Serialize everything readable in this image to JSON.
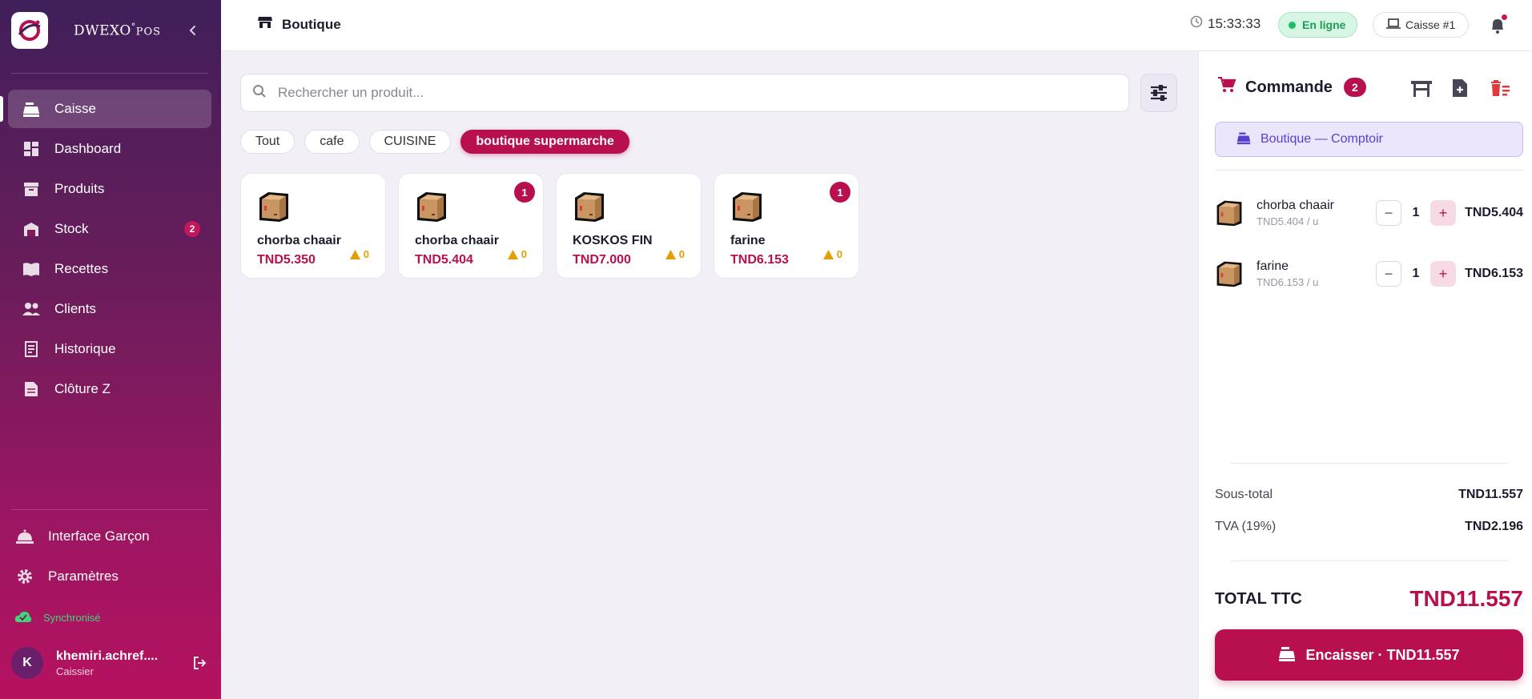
{
  "brand": {
    "name": "DWEXO",
    "suffix": "POS"
  },
  "sidebar": {
    "items": [
      {
        "label": "Caisse",
        "icon": "register-icon",
        "active": true
      },
      {
        "label": "Dashboard",
        "icon": "dashboard-icon"
      },
      {
        "label": "Produits",
        "icon": "box-icon"
      },
      {
        "label": "Stock",
        "icon": "warehouse-icon",
        "badge": "2"
      },
      {
        "label": "Recettes",
        "icon": "book-icon"
      },
      {
        "label": "Clients",
        "icon": "users-icon"
      },
      {
        "label": "Historique",
        "icon": "receipt-icon"
      },
      {
        "label": "Clôture Z",
        "icon": "document-icon"
      }
    ],
    "bottom_items": [
      {
        "label": "Interface Garçon",
        "icon": "cloche-icon"
      },
      {
        "label": "Paramètres",
        "icon": "gear-icon"
      }
    ],
    "sync_status": "Synchronisé",
    "user": {
      "initial": "K",
      "name": "khemiri.achref....",
      "role": "Caissier"
    }
  },
  "topbar": {
    "title": "Boutique",
    "time": "15:33:33",
    "status": "En ligne",
    "register": "Caisse #1"
  },
  "search": {
    "placeholder": "Rechercher un produit..."
  },
  "categories": [
    {
      "label": "Tout"
    },
    {
      "label": "cafe"
    },
    {
      "label": "CUISINE"
    },
    {
      "label": "boutique supermarche",
      "active": true
    }
  ],
  "products": [
    {
      "name": "chorba chaair",
      "price": "TND5.350",
      "stock": "0",
      "in_cart": ""
    },
    {
      "name": "chorba chaair",
      "price": "TND5.404",
      "stock": "0",
      "in_cart": "1"
    },
    {
      "name": "KOSKOS FIN",
      "price": "TND7.000",
      "stock": "0",
      "in_cart": ""
    },
    {
      "name": "farine",
      "price": "TND6.153",
      "stock": "0",
      "in_cart": "1"
    }
  ],
  "order": {
    "title": "Commande",
    "count": "2",
    "table": "Boutique — Comptoir",
    "lines": [
      {
        "name": "chorba chaair",
        "unit": "TND5.404 / u",
        "qty": "1",
        "total": "TND5.404"
      },
      {
        "name": "farine",
        "unit": "TND6.153 / u",
        "qty": "1",
        "total": "TND6.153"
      }
    ],
    "subtotal_label": "Sous-total",
    "subtotal": "TND11.557",
    "tax_label": "TVA (19%)",
    "tax": "TND2.196",
    "total_label": "TOTAL TTC",
    "total": "TND11.557",
    "pay_label": "Encaisser · TND11.557"
  },
  "colors": {
    "accent": "#b8104f",
    "online": "#1fbf65",
    "warning": "#e0a000"
  }
}
